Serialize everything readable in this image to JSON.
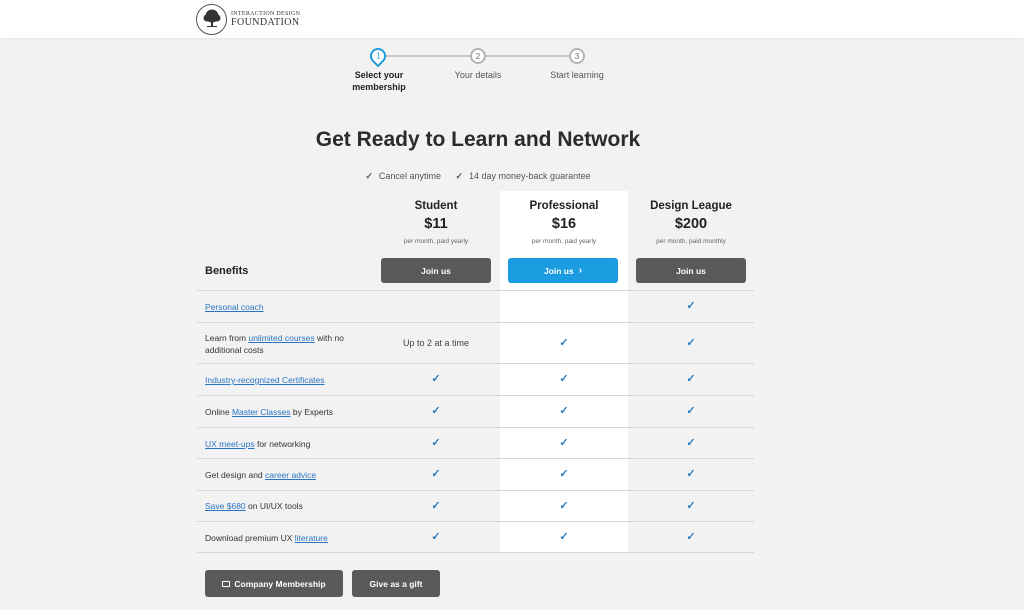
{
  "brand": {
    "line1": "INTERACTION DESIGN",
    "line2": "FOUNDATION"
  },
  "stepper": {
    "steps": [
      {
        "number": "1",
        "label_line1": "Select your",
        "label_line2": "membership"
      },
      {
        "number": "2",
        "label_line1": "Your details",
        "label_line2": ""
      },
      {
        "number": "3",
        "label_line1": "Start learning",
        "label_line2": ""
      }
    ]
  },
  "heading": "Get Ready to Learn and Network",
  "guarantees": [
    "Cancel anytime",
    "14 day money-back guarantee"
  ],
  "plans": [
    {
      "name": "Student",
      "price": "$11",
      "note": "per month, paid yearly",
      "button": "Join us"
    },
    {
      "name": "Professional",
      "price": "$16",
      "note": "per month, paid yearly",
      "button": "Join us"
    },
    {
      "name": "Design League",
      "price": "$200",
      "note": "per month, paid monthly",
      "button": "Join us"
    }
  ],
  "benefits_header": "Benefits",
  "benefits": [
    {
      "pre": "",
      "link": "Personal coach",
      "post": "",
      "student": "",
      "professional": "",
      "league": "✓"
    },
    {
      "pre": "Learn from ",
      "link": "unlimited courses",
      "post": " with no additional costs",
      "student": "Up to 2 at a time",
      "professional": "✓",
      "league": "✓"
    },
    {
      "pre": "",
      "link": "Industry-recognized Certificates",
      "post": "",
      "student": "✓",
      "professional": "✓",
      "league": "✓"
    },
    {
      "pre": "Online ",
      "link": "Master Classes",
      "post": " by Experts",
      "student": "✓",
      "professional": "✓",
      "league": "✓"
    },
    {
      "pre": "",
      "link": "UX meet-ups",
      "post": " for networking",
      "student": "✓",
      "professional": "✓",
      "league": "✓"
    },
    {
      "pre": "Get design and ",
      "link": "career advice",
      "post": "",
      "student": "✓",
      "professional": "✓",
      "league": "✓"
    },
    {
      "pre": "",
      "link": "Save $680",
      "post": " on UI/UX tools",
      "student": "✓",
      "professional": "✓",
      "league": "✓"
    },
    {
      "pre": "Download premium UX ",
      "link": "literature",
      "post": "",
      "student": "✓",
      "professional": "✓",
      "league": "✓"
    }
  ],
  "footer": {
    "company_button": "Company Membership",
    "gift_button": "Give as a gift"
  },
  "colors": {
    "accent": "#1b9be0",
    "button": "#5a5a5a",
    "link": "#2a74c6",
    "check": "#2a7cc0"
  }
}
